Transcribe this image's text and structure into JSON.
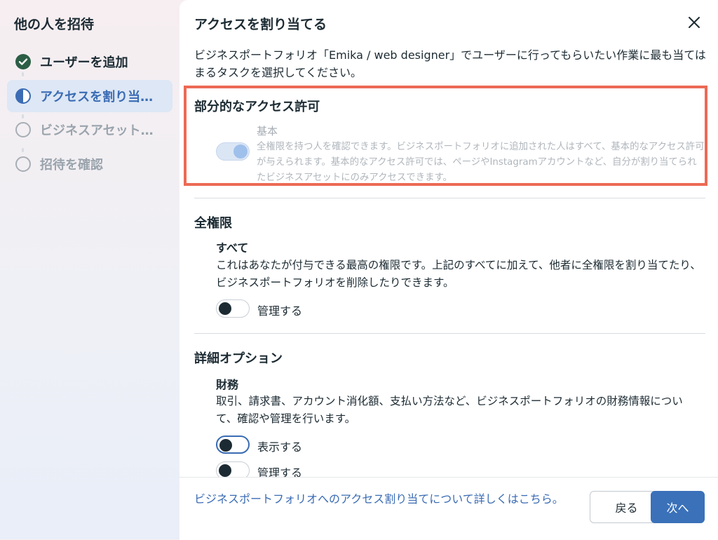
{
  "sidebar": {
    "title": "他の人を招待",
    "steps": [
      {
        "label": "ユーザーを追加",
        "state": "done"
      },
      {
        "label": "アクセスを割り当てる",
        "state": "active"
      },
      {
        "label": "ビジネスアセットを選択",
        "state": "pending"
      },
      {
        "label": "招待を確認",
        "state": "pending"
      }
    ]
  },
  "dialog": {
    "title": "アクセスを割り当てる",
    "close_icon": "close-icon",
    "intro": "ビジネスポートフォリオ「Emika / web designer」でユーザーに行ってもらいたい作業に最も当てはまるタスクを選択してください。"
  },
  "partial": {
    "title": "部分的なアクセス許可",
    "basic": {
      "title": "基本",
      "desc": "全権限を持つ人を確認できます。ビジネスポートフォリオに追加された人はすべて、基本的なアクセス許可が与えられます。基本的なアクセス許可では、ページやInstagramアカウントなど、自分が割り当てられたビジネスアセットにのみアクセスできます。",
      "toggle_on": true,
      "disabled": true
    }
  },
  "full": {
    "title": "全権限",
    "all": {
      "title": "すべて",
      "desc": "これはあなたが付与できる最高の権限です。上記のすべてに加えて、他者に全権限を割り当てたり、ビジネスポートフォリオを削除したりできます。",
      "toggle_label": "管理する",
      "toggle_on": false
    }
  },
  "detail": {
    "title": "詳細オプション",
    "finance": {
      "title": "財務",
      "desc": "取引、請求書、アカウント消化額、支払い方法など、ビジネスポートフォリオの財務情報について、確認や管理を行います。",
      "toggles": [
        {
          "label": "表示する",
          "on": false
        },
        {
          "label": "管理する",
          "on": false
        }
      ]
    }
  },
  "footer": {
    "help_link": "ビジネスポートフォリオへのアクセス割り当てについて詳しくはこちら。",
    "back": "戻る",
    "next": "次へ"
  },
  "colors": {
    "accent": "#3a71b9",
    "highlight": "#ec6a55",
    "done": "#2c5e45"
  }
}
